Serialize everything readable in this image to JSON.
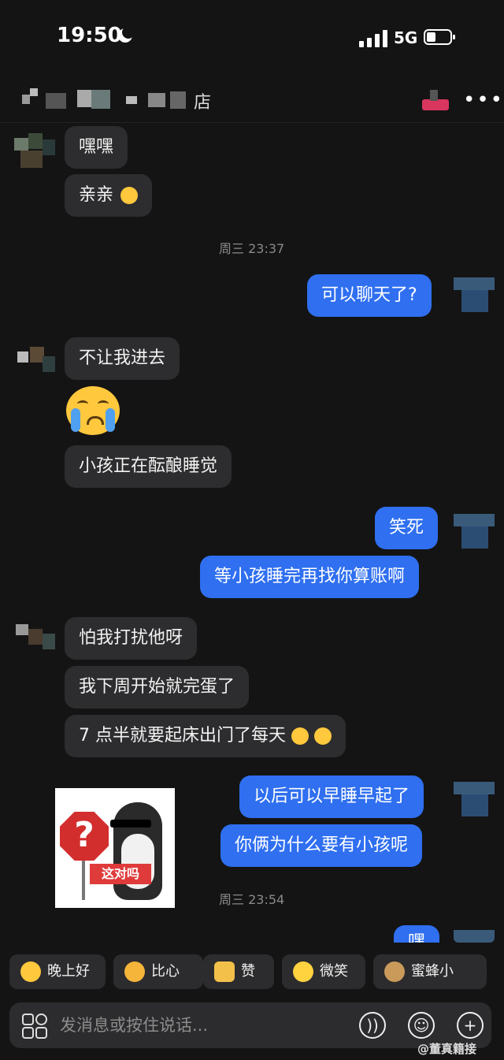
{
  "status_bar": {
    "time": "19:50",
    "network": "5G"
  },
  "header": {
    "title_visible_char": "店",
    "more": "•••"
  },
  "colors": {
    "background": "#141414",
    "incoming_bubble": "#2d2d2f",
    "outgoing_bubble": "#2f6ff0",
    "timestamp": "#8a8a8a"
  },
  "messages": {
    "m1": "嘿嘿",
    "m2": "亲亲",
    "t1": "周三 23:37",
    "m3": "可以聊天了?",
    "m4": "不让我进去",
    "m5": "小孩正在酝酿睡觉",
    "m6": "笑死",
    "m7": "等小孩睡完再找你算账啊",
    "m8": "怕我打扰他呀",
    "m9": "我下周开始就完蛋了",
    "m10": "7 点半就要起床出门了每天",
    "m11": "以后可以早睡早起了",
    "m12": "你俩为什么要有小孩呢",
    "t2": "周三 23:54",
    "sticker_text": "这对吗",
    "partial": "嘿"
  },
  "quick_replies": [
    "晚上好",
    "比心",
    "赞",
    "微笑",
    "蜜蜂小"
  ],
  "input": {
    "placeholder": "发消息或按住说话..."
  },
  "watermark": "@董真籍接"
}
